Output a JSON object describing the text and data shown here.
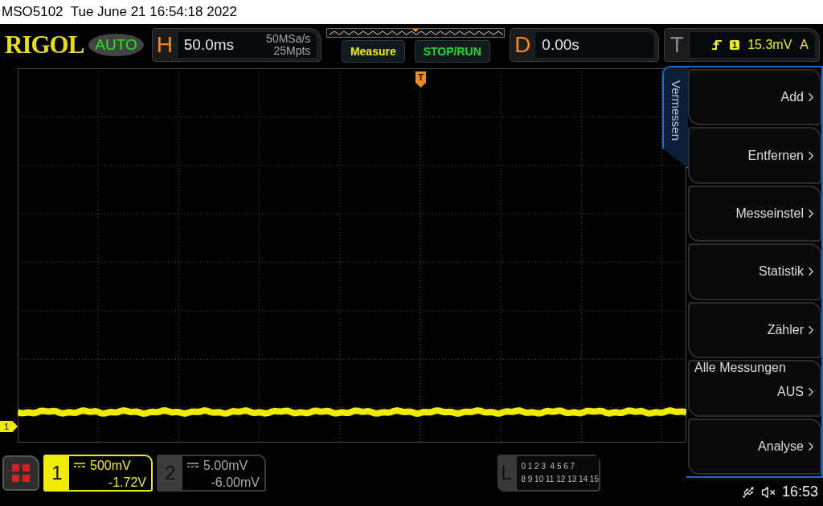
{
  "title_bar": {
    "text": "MSO5102  Tue June 21 16:54:18 2022"
  },
  "toolbar": {
    "logo": "RIGOL",
    "mode": "AUTO",
    "horizontal": {
      "label": "H",
      "timebase": "50.0ms",
      "sample_rate": "50MSa/s",
      "memory_depth": "25Mpts"
    },
    "buttons": [
      {
        "label": "Measure",
        "kind": "measure"
      },
      {
        "label": "STOP/RUN",
        "kind": "run"
      }
    ],
    "delay": {
      "label": "D",
      "value": "0.00s"
    },
    "trigger": {
      "label": "T",
      "source": "1",
      "trigger_level": "15.3mV",
      "sweep": "A"
    }
  },
  "screen": {
    "trigger_marker": "T",
    "channel_marker": "1"
  },
  "menu": {
    "tab": "Vermessen",
    "items": [
      {
        "kind": "submenu",
        "label": "Add"
      },
      {
        "kind": "submenu",
        "label": "Entfernen"
      },
      {
        "kind": "submenu",
        "label": "Messeinstel"
      },
      {
        "kind": "submenu",
        "label": "Statistik"
      },
      {
        "kind": "submenu",
        "label": "Zähler"
      },
      {
        "kind": "option",
        "label": "Alle Messungen",
        "value": "AUS"
      },
      {
        "kind": "submenu",
        "label": "Analyse"
      }
    ]
  },
  "channels": [
    {
      "number": "1",
      "scale": "500mV",
      "offset": "-1.72V",
      "on": true
    },
    {
      "number": "2",
      "scale": "5.00mV",
      "offset": "-6.00mV",
      "on": false
    }
  ],
  "logic": {
    "label": "L",
    "rows": [
      "0 1 2 3  4 5 6 7",
      "8 9 10 11 12 13 14 15"
    ]
  },
  "status": {
    "time": "16:53"
  }
}
